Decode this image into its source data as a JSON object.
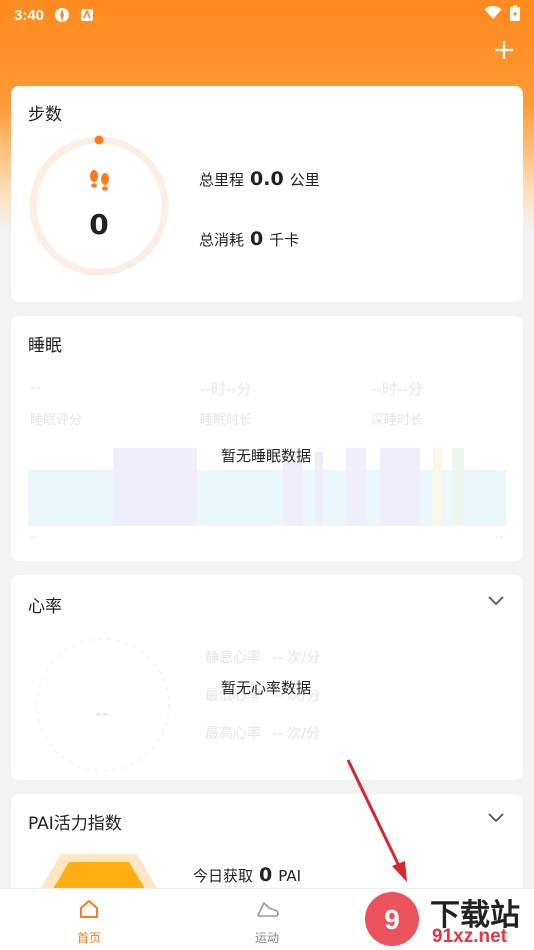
{
  "status_bar": {
    "time": "3:40"
  },
  "steps_card": {
    "title": "步数",
    "count": "0",
    "distance_label": "总里程",
    "distance_value": "0.0",
    "distance_unit": "公里",
    "calories_label": "总消耗",
    "calories_value": "0",
    "calories_unit": "千卡"
  },
  "sleep_card": {
    "title": "睡眠",
    "score_value": "--",
    "score_label": "睡眠评分",
    "duration_value": "--时--分",
    "duration_label": "睡眠时长",
    "deep_value": "--时--分",
    "deep_label": "深睡时长",
    "axis_left": "--",
    "axis_right": "--",
    "no_data": "暂无睡眠数据"
  },
  "heart_card": {
    "title": "心率",
    "center_value": "--",
    "resting_label": "静息心率",
    "resting_value": "-- 次/分",
    "avg_label": "最低心率",
    "avg_value": "-- 次/分",
    "max_label": "最高心率",
    "max_value": "-- 次/分",
    "no_data": "暂无心率数据"
  },
  "pai_card": {
    "title": "PAI活力指数",
    "today_label": "今日获取",
    "today_value": "0",
    "today_unit": "PAI"
  },
  "bottom_nav": {
    "home_label": "首页",
    "sport_label": "运动"
  },
  "watermark": {
    "text": "下载站",
    "domain": "91xz.net"
  },
  "colors": {
    "accent": "#ff7a1a",
    "ring": "#fdeee4"
  }
}
